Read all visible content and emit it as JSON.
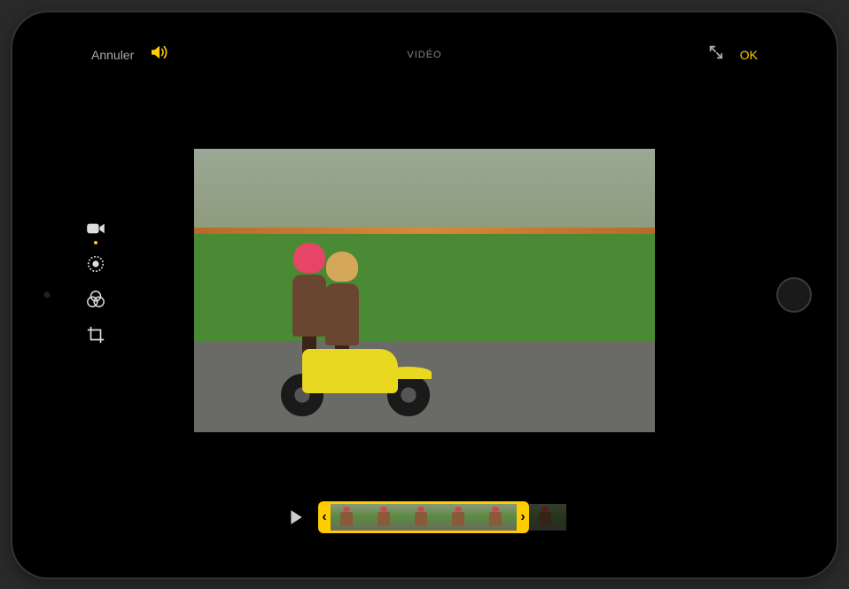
{
  "header": {
    "cancel": "Annuler",
    "title": "VIDÉO",
    "done": "OK"
  },
  "tools": {
    "video": "video",
    "adjust": "adjust",
    "filters": "filters",
    "crop": "crop",
    "active": "video"
  },
  "timeline": {
    "play": "play"
  },
  "colors": {
    "accent": "#ffcc00"
  }
}
